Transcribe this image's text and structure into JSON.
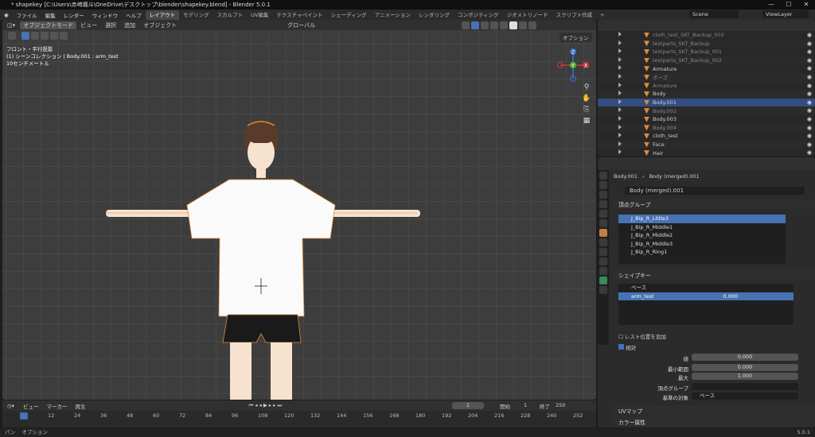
{
  "title": "* shapekey [C:\\Users\\赤﨑颯斗\\OneDrive\\デスクトップ\\blender\\shapekey.blend] - Blender 5.0.1",
  "menu": [
    "ファイル",
    "編集",
    "レンダー",
    "ウィンドウ",
    "ヘルプ"
  ],
  "workspaces": [
    "レイアウト",
    "モデリング",
    "スカルプト",
    "UV編集",
    "テクスチャペイント",
    "シェーディング",
    "アニメーション",
    "レンダリング",
    "コンポジティング",
    "ジオメトリノード",
    "スクリプト作成"
  ],
  "scene": "Scene",
  "viewlayer": "ViewLayer",
  "vp_header": {
    "mode": "オブジェクトモード",
    "view": "ビュー",
    "select": "選択",
    "add": "追加",
    "object": "オブジェクト",
    "orient": "グローバル",
    "options": "オプション"
  },
  "vp_info": {
    "line1": "フロント・平行投影",
    "line2": "(1) シーンコレクション | Body.001 : arm_test",
    "line3": "10センチメートル"
  },
  "timeline": {
    "view": "ビュー",
    "marker": "マーカー",
    "play": "再生",
    "frame": "1",
    "start_label": "開始",
    "start": "1",
    "end_label": "終了",
    "end": "250",
    "ticks": [
      "1",
      "12",
      "24",
      "36",
      "48",
      "60",
      "72",
      "84",
      "96",
      "108",
      "120",
      "132",
      "144",
      "156",
      "168",
      "180",
      "192",
      "204",
      "216",
      "228",
      "240",
      "252"
    ]
  },
  "status": {
    "pan": "パン",
    "options": "オプション",
    "version": "5.0.1"
  },
  "outliner": {
    "rows": [
      {
        "label": "cloth_test_SKT_Backup_003",
        "dim": true
      },
      {
        "label": "testparts_SKT_Backup",
        "dim": true
      },
      {
        "label": "testparts_SKT_Backup_001",
        "dim": true
      },
      {
        "label": "testparts_SKT_Backup_002",
        "dim": true
      },
      {
        "label": "Armature",
        "dim": false
      },
      {
        "label": "ポーズ",
        "dim": true
      },
      {
        "label": "Armature",
        "dim": true
      },
      {
        "label": "Body",
        "dim": false
      },
      {
        "label": "Body.001",
        "dim": false,
        "sel": true
      },
      {
        "label": "Body.002",
        "dim": true
      },
      {
        "label": "Body.003",
        "dim": false
      },
      {
        "label": "Body.004",
        "dim": true
      },
      {
        "label": "cloth_test",
        "dim": false
      },
      {
        "label": "Face",
        "dim": false
      },
      {
        "label": "Hair",
        "dim": false
      }
    ]
  },
  "props": {
    "breadcrumb1": "Body.001",
    "breadcrumb2": "Body (merged).001",
    "mesh": "Body (merged).001",
    "vg_title": "頂点グループ",
    "vgroups": [
      "J_Bip_R_Little3",
      "J_Bip_R_Middle1",
      "J_Bip_R_Middle2",
      "J_Bip_R_Middle3",
      "J_Bip_R_Ring1"
    ],
    "sk_title": "シェイプキー",
    "shapekeys": [
      {
        "name": "ベース",
        "value": ""
      },
      {
        "name": "arm_test",
        "value": "0.000"
      }
    ],
    "rest_label": "レスト位置を追加",
    "relative_label": "相対",
    "value_label": "値",
    "value": "0.000",
    "min_label": "最小範囲",
    "min": "0.000",
    "max_label": "最大",
    "max": "1.000",
    "vgroup_label": "頂点グループ",
    "relto_label": "基準の対象",
    "relto": "ベース",
    "uv_title": "UVマップ",
    "attr_title": "カラー属性"
  }
}
